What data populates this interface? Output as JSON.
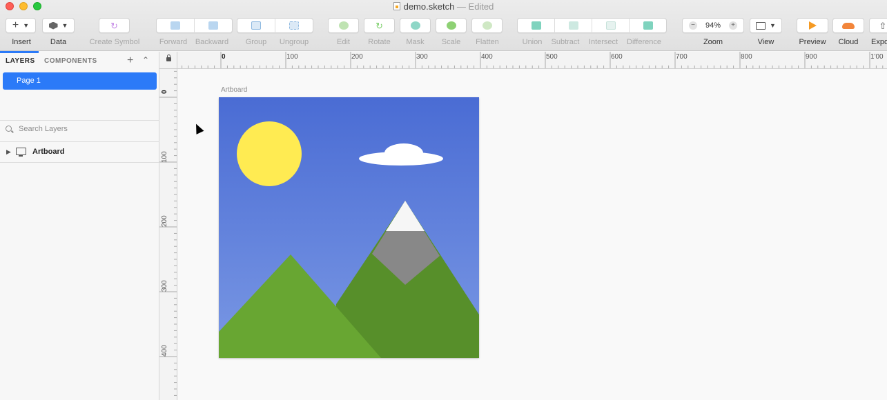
{
  "window": {
    "title": "demo.sketch",
    "status": "— Edited"
  },
  "toolbar": {
    "items": [
      {
        "label": "Insert",
        "icon": "plus-icon"
      },
      {
        "label": "Data",
        "icon": "data-stack-icon"
      },
      {
        "label": "Create Symbol",
        "icon": "symbol-icon"
      },
      {
        "label": "Forward",
        "icon": "forward-icon"
      },
      {
        "label": "Backward",
        "icon": "backward-icon"
      },
      {
        "label": "Group",
        "icon": "group-icon"
      },
      {
        "label": "Ungroup",
        "icon": "ungroup-icon"
      },
      {
        "label": "Edit",
        "icon": "edit-icon"
      },
      {
        "label": "Rotate",
        "icon": "rotate-icon"
      },
      {
        "label": "Mask",
        "icon": "mask-icon"
      },
      {
        "label": "Scale",
        "icon": "scale-icon"
      },
      {
        "label": "Flatten",
        "icon": "flatten-icon"
      },
      {
        "label": "Union",
        "icon": "union-icon"
      },
      {
        "label": "Subtract",
        "icon": "subtract-icon"
      },
      {
        "label": "Intersect",
        "icon": "intersect-icon"
      },
      {
        "label": "Difference",
        "icon": "difference-icon"
      },
      {
        "label": "Zoom",
        "icon": "zoom-icon"
      },
      {
        "label": "View",
        "icon": "view-icon"
      },
      {
        "label": "Preview",
        "icon": "play-icon"
      },
      {
        "label": "Cloud",
        "icon": "cloud-icon"
      },
      {
        "label": "Expo",
        "icon": "export-icon"
      }
    ],
    "zoom_value": "94%",
    "zoom_minus": "−",
    "zoom_plus": "+"
  },
  "sidebar": {
    "tab_layers": "LAYERS",
    "tab_components": "COMPONENTS",
    "add_glyph": "+",
    "collapse_glyph": "⌃",
    "page": "Page 1",
    "search_placeholder": "Search Layers",
    "layer_name": "Artboard",
    "expand_glyph": "▶"
  },
  "ruler": {
    "top_labels": [
      "0",
      "100",
      "200",
      "300",
      "400",
      "500",
      "600",
      "700",
      "800",
      "900",
      "1'00"
    ],
    "left_labels": [
      "0",
      "100",
      "200",
      "300",
      "400"
    ]
  },
  "canvas": {
    "artboard_label": "Artboard"
  },
  "colors": {
    "accent": "#2b7af8",
    "sky_top": "#4a6cd4",
    "sky_bottom": "#7a98e4",
    "sun": "#ffeb52",
    "cloud": "#ffffff",
    "mountain_front": "#68a632",
    "mountain_back": "#578f2a",
    "rock": "#888888",
    "snow": "#f6f6f6"
  }
}
